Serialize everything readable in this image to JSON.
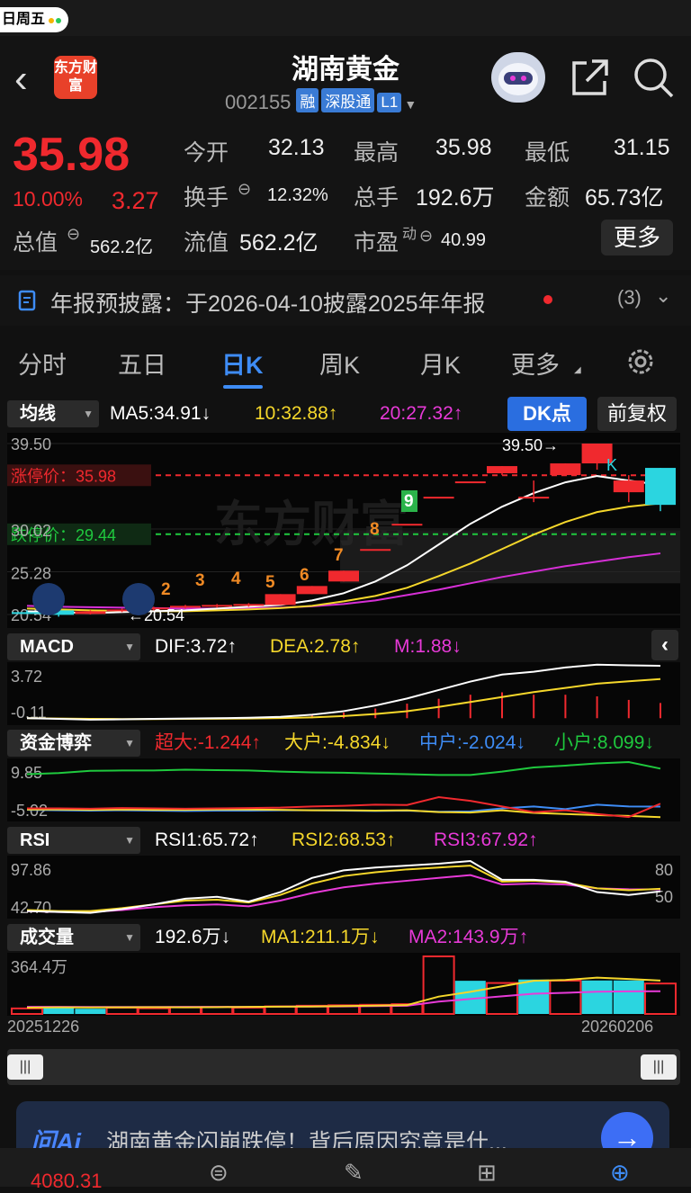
{
  "status": {
    "time_fragment": "日周五"
  },
  "header": {
    "title": "湖南黄金",
    "logo_text": "东方财富",
    "code": "002155",
    "tags": [
      "融",
      "深股通",
      "L1"
    ]
  },
  "quote": {
    "price": "35.98",
    "change_pct": "10.00%",
    "change": "3.27",
    "open_label": "今开",
    "open": "32.13",
    "high_label": "最高",
    "high": "35.98",
    "low_label": "最低",
    "low": "31.15",
    "turnover_label": "换手",
    "turnover": "12.32%",
    "volume_label": "总手",
    "volume": "192.6万",
    "amount_label": "金额",
    "amount": "65.73亿",
    "mktcap_label": "总值",
    "mktcap": "562.2亿",
    "float_label": "流值",
    "float": "562.2亿",
    "pe_label": "市盈",
    "pe_sup": "动",
    "pe": "40.99",
    "more": "更多"
  },
  "notice": {
    "text": "年报预披露：于2026-04-10披露2025年年报",
    "count": "(3)"
  },
  "tabs": [
    "分时",
    "五日",
    "日K",
    "周K",
    "月K",
    "更多"
  ],
  "active_tab": "日K",
  "kline": {
    "ma_button": "均线",
    "ma5": "MA5:34.91",
    "ma10": "10:32.88",
    "ma20": "20:27.32",
    "dk_button": "DK点",
    "restore_button": "前复权",
    "y_top": "39.50",
    "y_mid1": "30.02",
    "y_mid2": "25.28",
    "y_low": "20.54",
    "limit_up": "涨停价：35.98",
    "limit_down": "跌停价：29.44",
    "high_marker": "39.50→",
    "low_marker": "←20.54",
    "dk_letter": "K",
    "seq_nums": [
      "2",
      "3",
      "4",
      "5",
      "6",
      "7",
      "8",
      "9"
    ],
    "watermark": "东方财富"
  },
  "macd": {
    "button": "MACD",
    "dif": "DIF:3.72",
    "dea": "DEA:2.78",
    "m": "M:1.88",
    "y_top": "3.72",
    "y_bot": "-0.11"
  },
  "funds": {
    "button": "资金博弈",
    "super": "超大:-1.244",
    "large": "大户:-4.834",
    "mid": "中户:-2.024",
    "small": "小户:8.099",
    "y_top": "9.85",
    "y_bot": "-5.02"
  },
  "rsi": {
    "button": "RSI",
    "rsi1": "RSI1:65.72",
    "rsi2": "RSI2:68.53",
    "rsi3": "RSI3:67.92",
    "y_top": "97.86",
    "y_bot": "42.70",
    "r80": "80",
    "r50": "50"
  },
  "volume": {
    "button": "成交量",
    "vol": "192.6万",
    "ma1": "MA1:211.1万",
    "ma2": "MA2:143.9万",
    "y_top": "364.4万",
    "date_start": "20251226",
    "date_end": "20260206"
  },
  "ai": {
    "logo": "问Ai",
    "text": "湖南黄金闪崩跌停！背后原因究竟是什..."
  },
  "bottom": {
    "index": "4080.31"
  },
  "chart_data": {
    "type": "candlestick",
    "ohlc": [
      {
        "o": 20.8,
        "h": 21.0,
        "l": 20.6,
        "c": 20.7
      },
      {
        "o": 21.0,
        "h": 21.1,
        "l": 20.3,
        "c": 20.5
      },
      {
        "o": 20.6,
        "h": 21.0,
        "l": 20.54,
        "c": 20.9
      },
      {
        "o": 20.9,
        "h": 21.2,
        "l": 20.8,
        "c": 21.1
      },
      {
        "o": 21.1,
        "h": 21.4,
        "l": 21.0,
        "c": 21.3
      },
      {
        "o": 21.3,
        "h": 21.6,
        "l": 21.2,
        "c": 21.5
      },
      {
        "o": 21.5,
        "h": 21.7,
        "l": 21.3,
        "c": 21.6
      },
      {
        "o": 21.5,
        "h": 21.8,
        "l": 21.4,
        "c": 21.7
      },
      {
        "o": 21.6,
        "h": 22.8,
        "l": 21.6,
        "c": 22.8
      },
      {
        "o": 22.8,
        "h": 23.7,
        "l": 22.8,
        "c": 23.7
      },
      {
        "o": 24.2,
        "h": 25.4,
        "l": 24.2,
        "c": 25.4
      },
      {
        "o": 27.8,
        "h": 27.8,
        "l": 27.8,
        "c": 27.8
      },
      {
        "o": 30.6,
        "h": 30.6,
        "l": 30.6,
        "c": 30.6
      },
      {
        "o": 33.6,
        "h": 33.6,
        "l": 33.6,
        "c": 33.6
      },
      {
        "o": 35.3,
        "h": 35.3,
        "l": 35.3,
        "c": 35.3
      },
      {
        "o": 36.2,
        "h": 37.0,
        "l": 36.0,
        "c": 37.0
      },
      {
        "o": 33.6,
        "h": 35.4,
        "l": 33.0,
        "c": 33.6
      },
      {
        "o": 36.0,
        "h": 37.3,
        "l": 36.0,
        "c": 37.3
      },
      {
        "o": 37.3,
        "h": 39.5,
        "l": 36.6,
        "c": 39.5
      },
      {
        "o": 34.1,
        "h": 36.0,
        "l": 33.0,
        "c": 35.4
      },
      {
        "o": 36.8,
        "h": 36.8,
        "l": 32.0,
        "c": 32.7
      }
    ],
    "ma5": [
      20.9,
      20.8,
      20.7,
      20.8,
      20.9,
      21.0,
      21.2,
      21.4,
      21.6,
      22.1,
      22.9,
      24.2,
      26.0,
      28.3,
      30.6,
      32.5,
      34.0,
      35.2,
      35.9,
      35.4,
      34.91
    ],
    "ma10": [
      21.2,
      21.1,
      21.0,
      20.95,
      20.9,
      20.9,
      21.0,
      21.1,
      21.25,
      21.5,
      22.0,
      22.6,
      23.5,
      24.8,
      26.2,
      27.8,
      29.4,
      30.8,
      31.9,
      32.5,
      32.88
    ],
    "ma20": [
      21.5,
      21.4,
      21.35,
      21.3,
      21.25,
      21.2,
      21.2,
      21.25,
      21.3,
      21.45,
      21.7,
      22.1,
      22.7,
      23.3,
      24.0,
      24.7,
      25.3,
      25.9,
      26.4,
      26.9,
      27.32
    ],
    "macd": {
      "dif": [
        0.0,
        -0.05,
        -0.1,
        -0.08,
        -0.05,
        -0.02,
        0.0,
        0.03,
        0.1,
        0.25,
        0.5,
        0.9,
        1.4,
        2.0,
        2.6,
        3.1,
        3.3,
        3.6,
        3.8,
        3.75,
        3.72
      ],
      "dea": [
        0.0,
        -0.02,
        -0.05,
        -0.06,
        -0.06,
        -0.05,
        -0.04,
        -0.02,
        0.01,
        0.06,
        0.15,
        0.3,
        0.5,
        0.8,
        1.15,
        1.5,
        1.85,
        2.15,
        2.45,
        2.62,
        2.78
      ],
      "m": [
        0.0,
        0.0,
        0.0,
        0.0,
        0.0,
        0.0,
        0.0,
        0.0,
        0.0,
        0.2,
        0.35,
        0.6,
        0.9,
        1.2,
        1.45,
        1.6,
        1.45,
        1.45,
        1.35,
        1.13,
        0.94
      ]
    },
    "funds": {
      "super": [
        -2.5,
        -2.5,
        -2.6,
        -2.4,
        -2.5,
        -2.6,
        -2.5,
        -2.4,
        -2.3,
        -2.0,
        -1.8,
        -1.5,
        -1.6,
        0.5,
        -0.5,
        -2.0,
        -3.5,
        -3.0,
        -4.0,
        -4.8,
        -1.244
      ],
      "large": [
        -2.8,
        -2.8,
        -2.9,
        -2.8,
        -2.9,
        -2.9,
        -2.8,
        -2.8,
        -2.9,
        -3.0,
        -3.0,
        -3.1,
        -3.0,
        -3.5,
        -3.6,
        -3.0,
        -3.7,
        -4.0,
        -4.3,
        -4.5,
        -4.834
      ],
      "mid": [
        -2.9,
        -3.0,
        -3.1,
        -3.0,
        -3.1,
        -3.2,
        -3.1,
        -3.1,
        -3.0,
        -3.0,
        -3.1,
        -3.2,
        -3.1,
        -3.4,
        -3.3,
        -2.5,
        -2.0,
        -2.7,
        -1.5,
        -2.0,
        -2.024
      ],
      "small": [
        6.6,
        6.9,
        7.5,
        7.6,
        7.6,
        7.8,
        7.7,
        7.6,
        7.3,
        7.1,
        7.0,
        6.8,
        6.6,
        6.4,
        6.4,
        7.3,
        8.4,
        8.9,
        9.5,
        9.85,
        8.099
      ]
    },
    "rsi": {
      "rsi1": [
        45,
        44,
        43,
        47,
        52,
        58,
        60,
        55,
        65,
        80,
        88,
        91,
        93,
        95,
        97.86,
        78,
        78,
        76,
        65,
        62,
        65.72
      ],
      "rsi2": [
        46,
        45,
        45,
        48,
        52,
        56,
        57,
        54,
        62,
        74,
        82,
        86,
        89,
        91,
        93,
        76,
        77,
        75,
        69,
        67,
        68.53
      ],
      "rsi3": [
        45,
        44,
        44,
        46,
        49,
        51,
        52,
        50,
        56,
        64,
        70,
        74,
        77,
        80,
        83,
        73,
        74,
        73,
        69,
        68,
        67.92
      ]
    },
    "volume": {
      "values": [
        35,
        38,
        33,
        40,
        36,
        42,
        44,
        40,
        48,
        52,
        55,
        58,
        62,
        364.4,
        210,
        196,
        218,
        211,
        212,
        212,
        192.6
      ],
      "up": [
        true,
        false,
        false,
        true,
        true,
        true,
        true,
        true,
        true,
        true,
        true,
        true,
        true,
        true,
        false,
        true,
        false,
        true,
        false,
        false,
        true
      ],
      "ma1": [
        40,
        42,
        41,
        42,
        43,
        42,
        43,
        45,
        46,
        47,
        50,
        53,
        56,
        110,
        140,
        175,
        210,
        215,
        230,
        221,
        211.1
      ],
      "ma2": [
        45,
        45,
        44,
        44,
        44,
        45,
        45,
        45,
        46,
        47,
        48,
        50,
        52,
        78,
        95,
        112,
        128,
        134,
        141,
        143,
        143.9
      ]
    }
  }
}
